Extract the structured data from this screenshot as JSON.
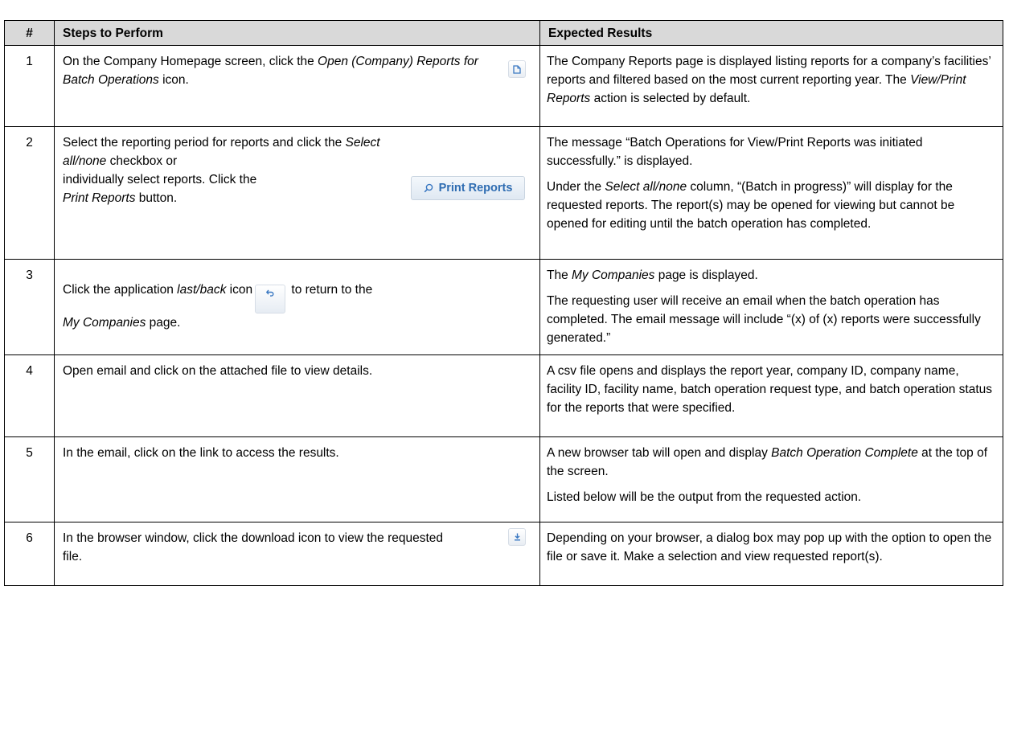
{
  "headers": {
    "num": "#",
    "steps": "Steps to Perform",
    "results": "Expected Results"
  },
  "rows": [
    {
      "num": "1",
      "step": {
        "t1": "On the Company Homepage screen, click the ",
        "i1": "Open (Company) Reports for Batch Operations",
        "t2": " icon."
      },
      "results": [
        {
          "t1": "The Company Reports page is displayed listing reports for a company’s facilities’ reports and filtered based on the most current reporting year. The ",
          "i1": "View/Print Reports",
          "t2": " action is selected by default."
        }
      ]
    },
    {
      "num": "2",
      "step": {
        "t1": "Select the reporting period for reports and click the ",
        "i1": "Select all/none",
        "t2": " checkbox or",
        "t3": "individually select reports. Click the",
        "i2": "Print Reports",
        "t4": " button.",
        "button": "Print Reports"
      },
      "results": [
        {
          "t1": "The message “Batch Operations for View/Print Reports was initiated successfully.” is displayed."
        },
        {
          "t1": "Under the ",
          "i1": "Select all/none",
          "t2": " column, “(Batch in progress)” will display for the requested reports. The report(s) may be opened for viewing but cannot be opened for editing until the batch operation has completed."
        }
      ]
    },
    {
      "num": "3",
      "step": {
        "t1": "Click the application ",
        "i1": "last/back",
        "t2": " icon",
        "t3": " to return to the ",
        "i2": "My Companies",
        "t4": " page."
      },
      "results": [
        {
          "t1": "The ",
          "i1": "My Companies",
          "t2": " page is displayed."
        },
        {
          "t1": "The requesting user will receive an email when the batch operation has completed. The email message will include “(x) of (x) reports were successfully generated.”"
        }
      ]
    },
    {
      "num": "4",
      "step": {
        "t1": "Open email and click on the attached file to view details."
      },
      "results": [
        {
          "t1": "A csv file opens and displays the report year, company ID, company name, facility ID, facility name, batch operation request type, and batch operation status for the reports that were specified."
        }
      ]
    },
    {
      "num": "5",
      "step": {
        "t1": "In the email, click on the link to access the results."
      },
      "results": [
        {
          "t1": "A new browser tab will open and display ",
          "i1": "Batch Operation Complete",
          "t2": " at the top of the screen."
        },
        {
          "t1": "Listed below will be the output from the requested action."
        }
      ]
    },
    {
      "num": "6",
      "step": {
        "t1": "In the browser window, click the download icon to view the requested file."
      },
      "results": [
        {
          "t1": "Depending on your browser, a dialog box may pop up with the option to open the file or save it. Make a selection and view requested report(s)."
        }
      ]
    }
  ],
  "icons": {
    "row1": "document-icon",
    "row2": "search-icon",
    "row3": "undo-arrow-icon",
    "row6": "download-icon"
  },
  "colors": {
    "header_bg": "#d9d9d9",
    "icon_blue": "#3a78c2"
  }
}
